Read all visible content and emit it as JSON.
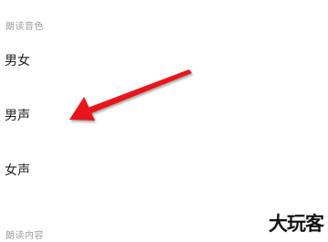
{
  "sections": {
    "voice_label": "朗读音色",
    "content_label": "朗读内容"
  },
  "voice_options": [
    {
      "label": "男女"
    },
    {
      "label": "男声"
    },
    {
      "label": "女声"
    }
  ],
  "watermark": {
    "text": "大玩客"
  },
  "colors": {
    "arrow": "#e8191b",
    "label": "#9e9e9e",
    "text": "#1f1f1f"
  }
}
